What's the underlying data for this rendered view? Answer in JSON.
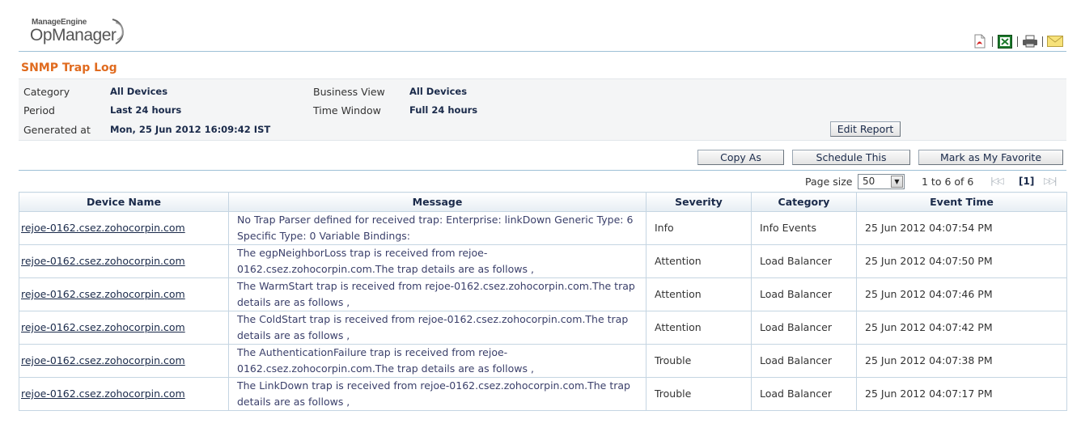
{
  "header": {
    "brand_small": "ManageEngine",
    "brand_name": "OpManager",
    "icons": [
      "pdf-icon",
      "excel-icon",
      "print-icon",
      "email-icon"
    ]
  },
  "report": {
    "title": "SNMP Trap Log",
    "category_label": "Category",
    "category_value": "All Devices",
    "period_label": "Period",
    "period_value": "Last 24 hours",
    "generated_label": "Generated at",
    "generated_value": "Mon, 25 Jun 2012 16:09:42 IST",
    "business_view_label": "Business View",
    "business_view_value": "All Devices",
    "time_window_label": "Time Window",
    "time_window_value": "Full 24 hours",
    "edit_report_label": "Edit Report"
  },
  "actions": {
    "copy_as": "Copy As",
    "schedule_this": "Schedule This",
    "mark_favorite": "Mark as My Favorite"
  },
  "pager": {
    "page_size_label": "Page size",
    "page_size_value": "50",
    "range": "1 to 6 of 6",
    "current_page": "[1]"
  },
  "table": {
    "columns": [
      "Device Name",
      "Message",
      "Severity",
      "Category",
      "Event Time"
    ],
    "rows": [
      {
        "device": "rejoe-0162.csez.zohocorpin.com",
        "message": "No Trap Parser defined for received trap: Enterprise: linkDown Generic Type: 6 Specific Type: 0 Variable Bindings:",
        "severity": "Info",
        "category": "Info Events",
        "time": "25 Jun 2012 04:07:54 PM"
      },
      {
        "device": "rejoe-0162.csez.zohocorpin.com",
        "message": "The egpNeighborLoss trap is received from rejoe-0162.csez.zohocorpin.com.The trap details are as follows ,",
        "severity": "Attention",
        "category": "Load Balancer",
        "time": "25 Jun 2012 04:07:50 PM"
      },
      {
        "device": "rejoe-0162.csez.zohocorpin.com",
        "message": "The WarmStart trap is received from rejoe-0162.csez.zohocorpin.com.The trap details are as follows ,",
        "severity": "Attention",
        "category": "Load Balancer",
        "time": "25 Jun 2012 04:07:46 PM"
      },
      {
        "device": "rejoe-0162.csez.zohocorpin.com",
        "message": "The ColdStart trap is received from rejoe-0162.csez.zohocorpin.com.The trap details are as follows ,",
        "severity": "Attention",
        "category": "Load Balancer",
        "time": "25 Jun 2012 04:07:42 PM"
      },
      {
        "device": "rejoe-0162.csez.zohocorpin.com",
        "message": "The AuthenticationFailure trap is received from rejoe-0162.csez.zohocorpin.com.The trap details are as follows ,",
        "severity": "Trouble",
        "category": "Load Balancer",
        "time": "25 Jun 2012 04:07:38 PM"
      },
      {
        "device": "rejoe-0162.csez.zohocorpin.com",
        "message": "The LinkDown trap is received from rejoe-0162.csez.zohocorpin.com.The trap details are as follows ,",
        "severity": "Trouble",
        "category": "Load Balancer",
        "time": "25 Jun 2012 04:07:17 PM"
      }
    ]
  }
}
